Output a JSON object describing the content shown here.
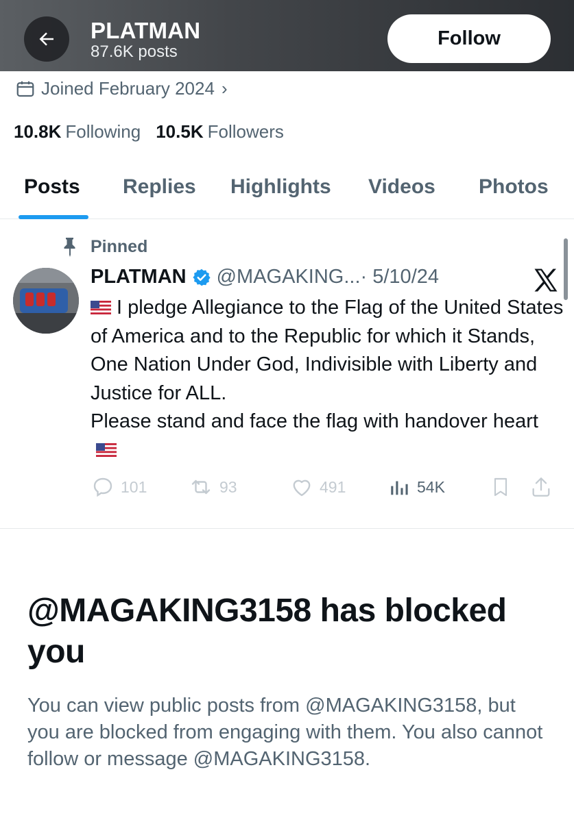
{
  "header": {
    "name": "PLATMAN",
    "posts_count": "87.6K posts",
    "follow_label": "Follow"
  },
  "profile": {
    "joined": "Joined February 2024",
    "following_count": "10.8K",
    "following_label": "Following",
    "followers_count": "10.5K",
    "followers_label": "Followers"
  },
  "tabs": [
    {
      "label": "Posts",
      "active": true
    },
    {
      "label": "Replies",
      "active": false
    },
    {
      "label": "Highlights",
      "active": false
    },
    {
      "label": "Videos",
      "active": false
    },
    {
      "label": "Photos",
      "active": false
    }
  ],
  "pinned_post": {
    "pinned_label": "Pinned",
    "author_name": "PLATMAN",
    "handle": "@MAGAKING...",
    "date": "· 5/10/24",
    "text": "I pledge Allegiance to the Flag of the United States of America and to the Republic for which it Stands, One Nation Under God, Indivisible with Liberty and Justice for ALL.",
    "text_line2": "Please stand and face the flag with handover heart",
    "replies": "101",
    "reposts": "93",
    "likes": "491",
    "views": "54K"
  },
  "blocked": {
    "title": "@MAGAKING3158 has blocked you",
    "description": "You can view public posts from @MAGAKING3158, but you are blocked from engaging with them. You also cannot follow or message @MAGAKING3158."
  },
  "colors": {
    "accent": "#1d9bf0",
    "text_primary": "#0f1419",
    "text_secondary": "#536471",
    "verified": "#1d9bf0"
  }
}
